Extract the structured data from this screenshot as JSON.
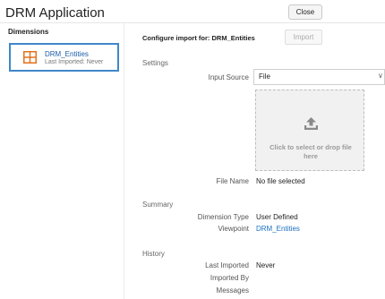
{
  "app": {
    "title": "DRM Application",
    "close_label": "Close"
  },
  "sidebar": {
    "heading": "Dimensions",
    "items": [
      {
        "name": "DRM_Entities",
        "subtitle": "Last Imported: Never",
        "icon": "grid-icon"
      }
    ]
  },
  "main": {
    "configure_title": "Configure import for: DRM_Entities",
    "import_label": "Import",
    "settings": {
      "heading": "Settings",
      "input_source_label": "Input Source",
      "input_source_value": "File",
      "dropzone_text": "Click to select or drop file here",
      "file_name_label": "File Name",
      "file_name_value": "No file selected"
    },
    "summary": {
      "heading": "Summary",
      "dimension_type_label": "Dimension Type",
      "dimension_type_value": "User Defined",
      "viewpoint_label": "Viewpoint",
      "viewpoint_value": "DRM_Entities"
    },
    "history": {
      "heading": "History",
      "last_imported_label": "Last Imported",
      "last_imported_value": "Never",
      "imported_by_label": "Imported By",
      "imported_by_value": "",
      "messages_label": "Messages"
    }
  },
  "colors": {
    "accent": "#3f87c9",
    "link": "#1a6fbf",
    "icon": "#e2731e"
  }
}
